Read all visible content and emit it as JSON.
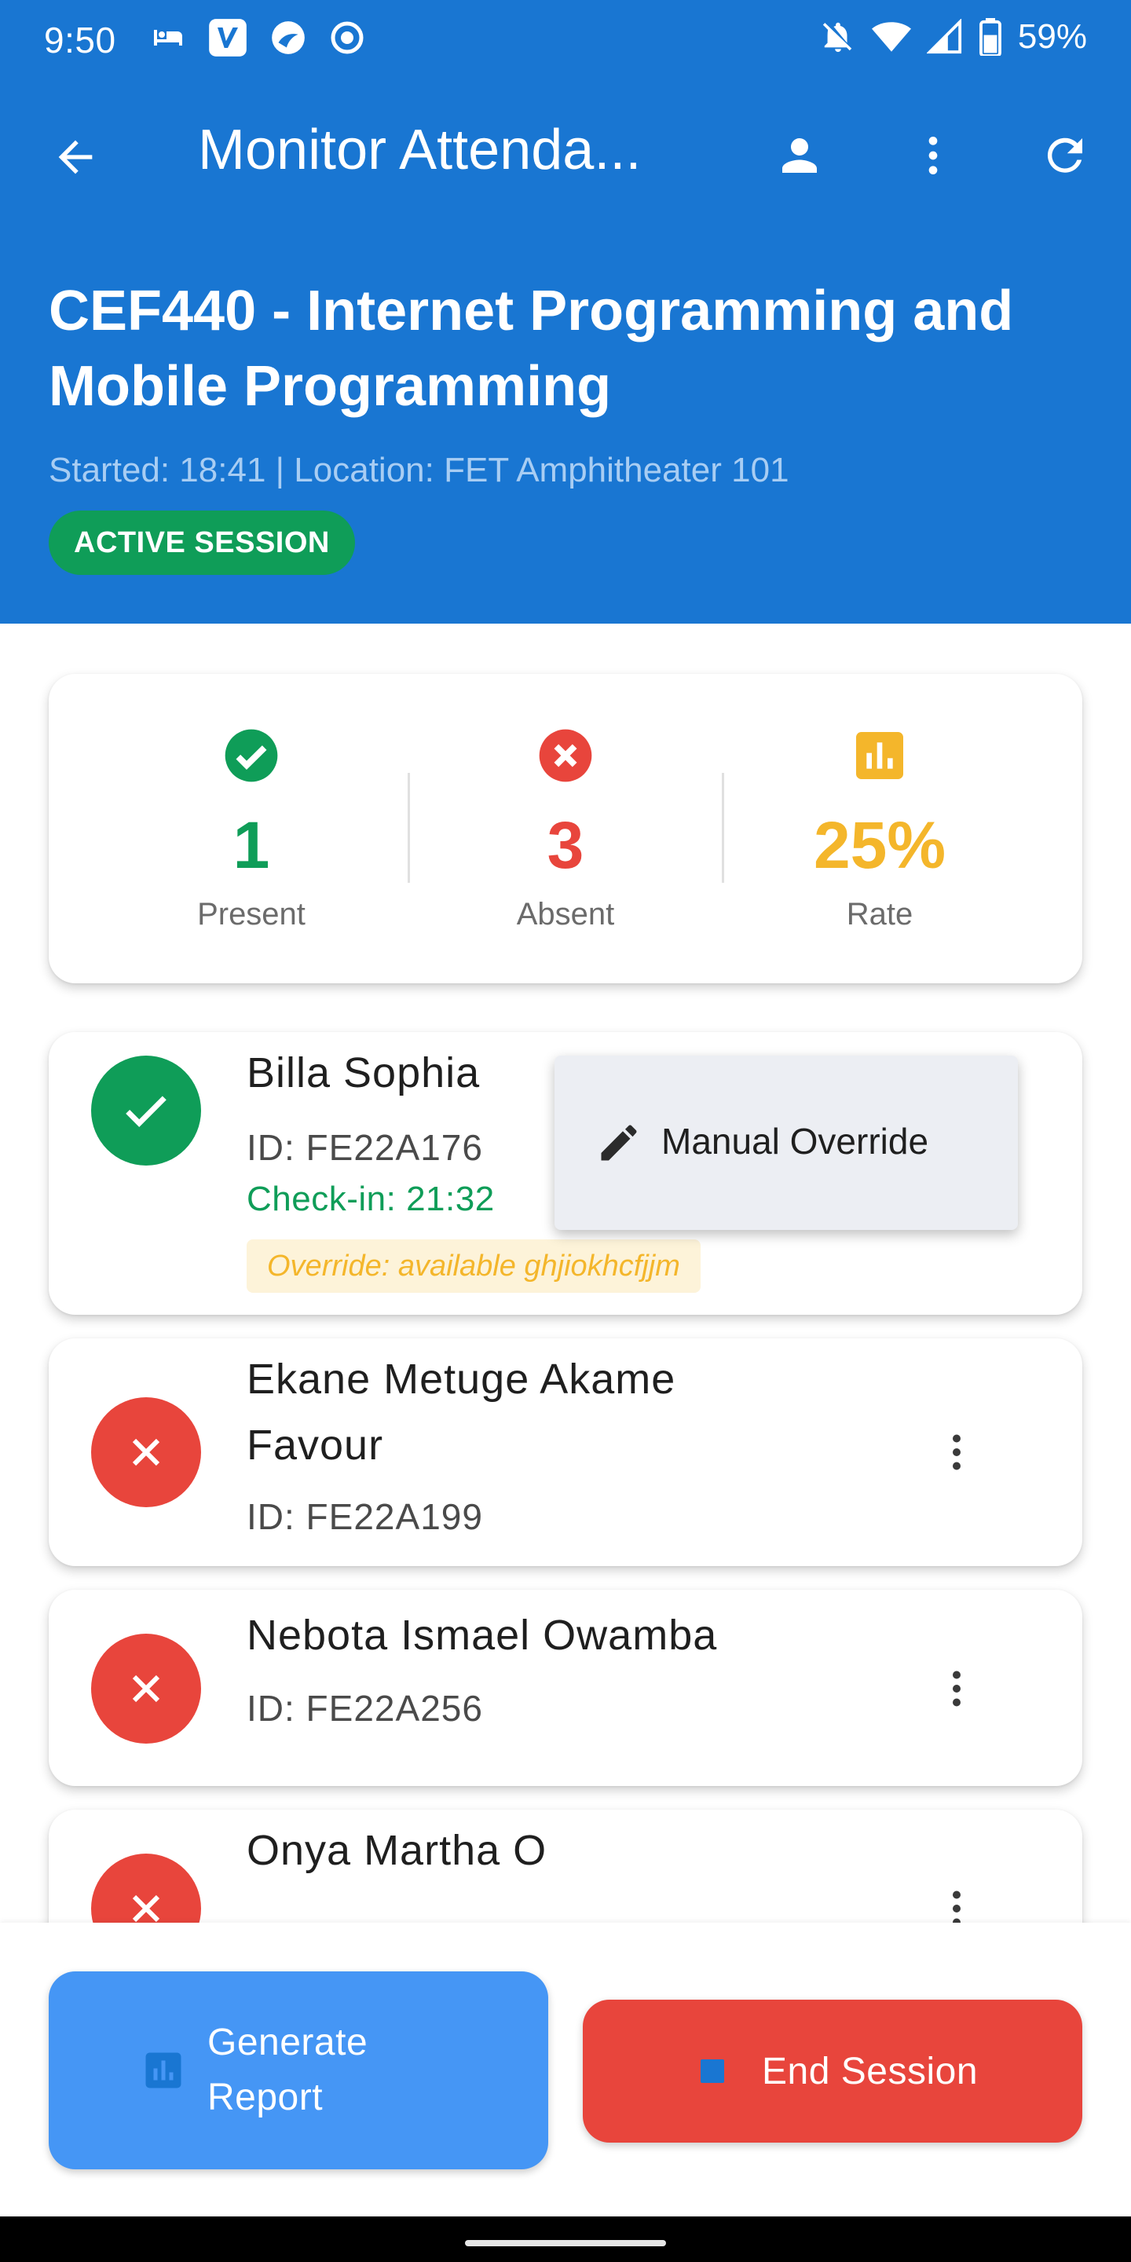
{
  "status_bar": {
    "time": "9:50",
    "battery_percent": "59%",
    "left_icons": [
      "bed-icon",
      "venmo-icon",
      "app-icon",
      "record-icon"
    ],
    "right_icons": [
      "notifications-off-icon",
      "wifi-icon",
      "signal-icon",
      "battery-icon"
    ]
  },
  "app_bar": {
    "title": "Monitor Attenda...",
    "icons": [
      "back-arrow-icon",
      "person-icon",
      "more-vert-icon",
      "refresh-icon"
    ]
  },
  "session": {
    "course_title": "CEF440 - Internet Programming and Mobile Programming",
    "meta": "Started: 18:41 | Location: FET Amphitheater 101",
    "status_badge": "ACTIVE SESSION"
  },
  "stats": {
    "present": {
      "value": "1",
      "label": "Present",
      "icon": "check-circle-icon",
      "color": "#0f9d58"
    },
    "absent": {
      "value": "3",
      "label": "Absent",
      "icon": "cancel-circle-icon",
      "color": "#e8453c"
    },
    "rate": {
      "value": "25%",
      "label": "Rate",
      "icon": "bar-chart-icon",
      "color": "#f4b62b"
    }
  },
  "students": [
    {
      "name": "Billa Sophia",
      "id": "ID: FE22A176",
      "checkin": "Check-in: 21:32",
      "override_note": "Override: available ghjiokhcfjjm",
      "status": "present"
    },
    {
      "name": "Ekane Metuge Akame Favour",
      "id": "ID: FE22A199",
      "status": "absent"
    },
    {
      "name": "Nebota Ismael Owamba",
      "id": "ID: FE22A256",
      "status": "absent"
    },
    {
      "name": "Onya Martha O",
      "status": "absent"
    }
  ],
  "popup_menu": {
    "item_label": "Manual Override",
    "item_icon": "edit-pencil-icon"
  },
  "actions": {
    "report_label": "Generate Report",
    "end_label": "End Session"
  },
  "colors": {
    "primary": "#1976d2",
    "present": "#0f9d58",
    "absent": "#e8453c",
    "rate": "#f4b62b",
    "report_button": "#4596f5"
  }
}
